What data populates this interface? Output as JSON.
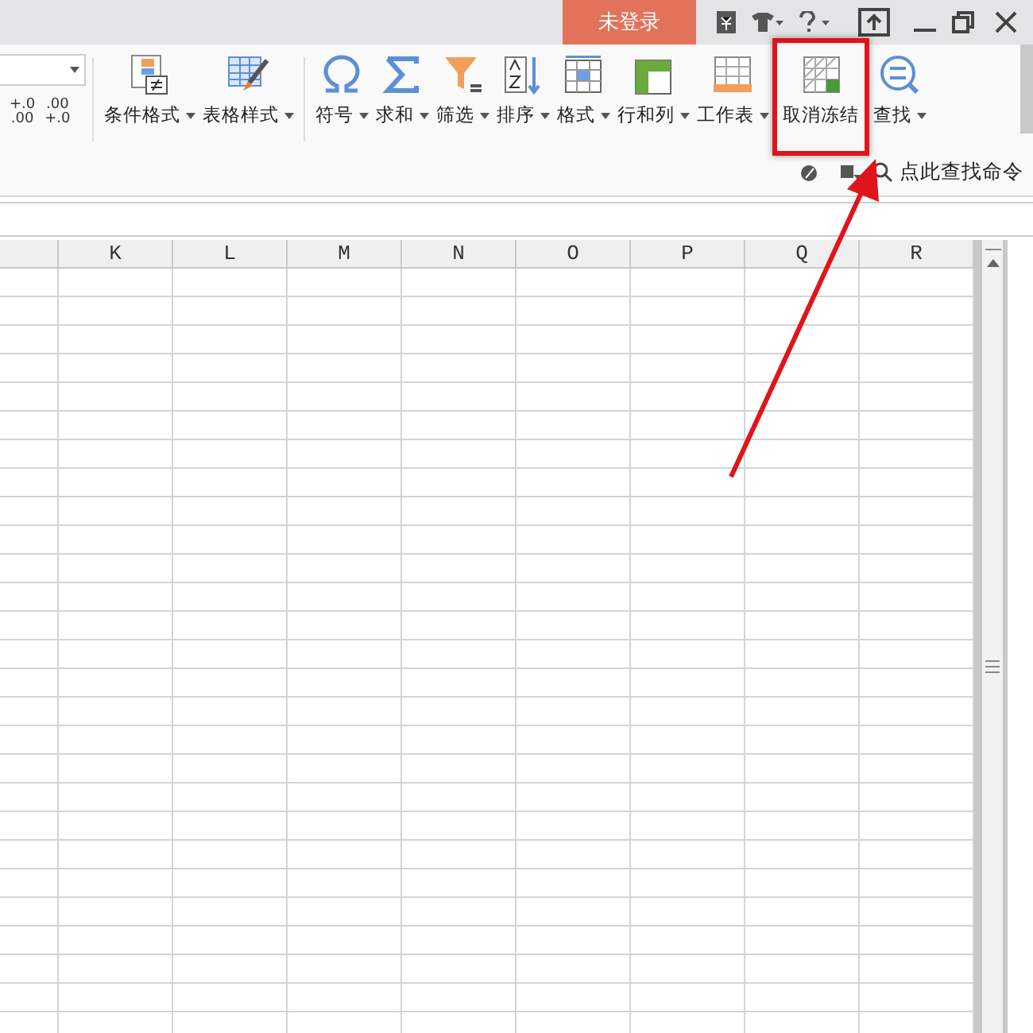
{
  "title_bar": {
    "login_button": "未登录"
  },
  "ribbon": {
    "number_format": {
      "increase_decimal": "+.0\n.00",
      "decrease_decimal": ".00\n+.0"
    },
    "groups": [
      [
        {
          "label": "条件格式",
          "kind": "conditional",
          "dropdown": true
        },
        {
          "label": "表格样式",
          "kind": "tablestyle",
          "dropdown": true
        }
      ],
      [
        {
          "label": "符号",
          "kind": "omega",
          "dropdown": true
        },
        {
          "label": "求和",
          "kind": "sigma",
          "dropdown": true
        },
        {
          "label": "筛选",
          "kind": "filter",
          "dropdown": true
        },
        {
          "label": "排序",
          "kind": "sort",
          "dropdown": true
        },
        {
          "label": "格式",
          "kind": "format",
          "dropdown": true
        },
        {
          "label": "行和列",
          "kind": "rowcol",
          "dropdown": true
        },
        {
          "label": "工作表",
          "kind": "sheet",
          "dropdown": true
        },
        {
          "label": "取消冻结",
          "kind": "freeze",
          "dropdown": false,
          "highlighted": true
        },
        {
          "label": "查找",
          "kind": "find",
          "dropdown": true
        }
      ]
    ],
    "command_search": "点此查找命令"
  },
  "sheet": {
    "columns": [
      "K",
      "L",
      "M",
      "N",
      "O",
      "P",
      "Q",
      "R"
    ]
  }
}
